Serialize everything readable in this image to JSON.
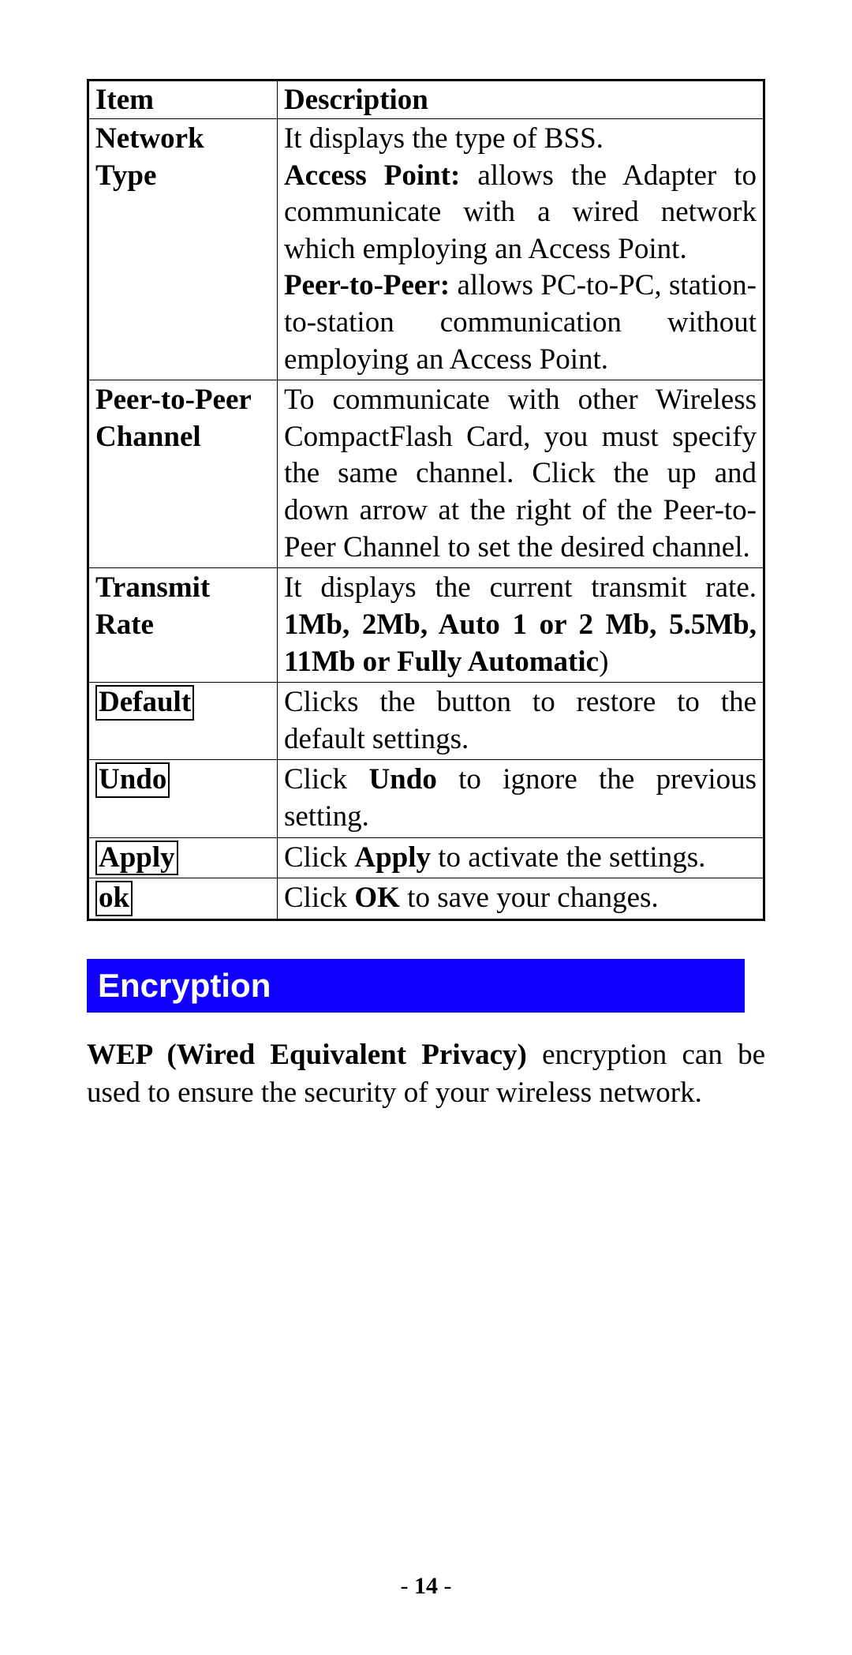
{
  "table": {
    "headers": {
      "item": "Item",
      "description": "Description"
    },
    "rows": {
      "networkType": {
        "item": "Network Type"
      },
      "peerChannel": {
        "item": "Peer-to-Peer Channel",
        "desc": "To communicate with other Wireless CompactFlash Card, you must specify the same channel. Click the up and down arrow at the right of the Peer-to-Peer Channel to set the desired channel."
      },
      "transmitRate": {
        "item": "Transmit Rate"
      },
      "default": {
        "item": "Default",
        "desc": "Clicks the button to restore to the default settings."
      },
      "undo": {
        "item": "Undo"
      },
      "apply": {
        "item": "Apply"
      },
      "ok": {
        "item": "ok"
      }
    },
    "fragments": {
      "nt_line1": "It displays the type of BSS.",
      "nt_ap_label": "Access Point:",
      "nt_ap_text": " allows the Adapter to communicate with a wired network which employing an Access Point.",
      "nt_p2p_label": "Peer-to-Peer:",
      "nt_p2p_text": " allows PC-to-PC, station-to-station communication without employing an Access Point.",
      "tr_pre": "It displays the current transmit rate. ",
      "tr_bold": "1Mb, 2Mb, Auto 1 or 2 Mb, 5.5Mb, 11Mb or Fully Automatic",
      "tr_post": ")",
      "undo_pre": "Click ",
      "undo_b": "Undo",
      "undo_post": " to ignore the previous setting.",
      "apply_pre": "Click ",
      "apply_b": "Apply",
      "apply_post": " to activate the settings.",
      "ok_pre": "Click ",
      "ok_b": "OK",
      "ok_post": " to save your changes."
    }
  },
  "section": {
    "title": "Encryption"
  },
  "paragraph": {
    "bold": "WEP (Wired Equivalent Privacy)",
    "rest": " encryption can be used to ensure the security of your wireless network."
  },
  "pageNumber": {
    "dash1": "- ",
    "num": "14",
    "dash2": " -"
  }
}
